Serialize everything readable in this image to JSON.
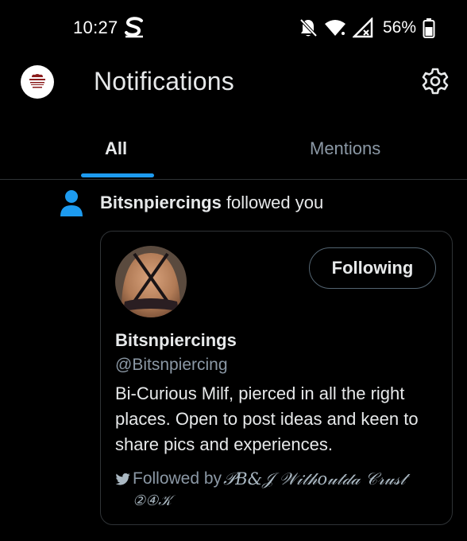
{
  "status_bar": {
    "time": "10:27",
    "carrier_icon": "s-letter-icon",
    "battery_percent": "56%"
  },
  "header": {
    "title": "Notifications",
    "avatar_icon": "avatar",
    "settings_icon": "gear-icon"
  },
  "tabs": [
    {
      "label": "All",
      "active": true
    },
    {
      "label": "Mentions",
      "active": false
    }
  ],
  "notification": {
    "icon": "person-icon",
    "actor": "Bitsnpiercings",
    "action": "followed you"
  },
  "profile_card": {
    "follow_button_label": "Following",
    "display_name": "Bitsnpiercings",
    "handle": "@Bitsnpiercing",
    "bio": "Bi-Curious Milf, pierced in all the right places. Open to post ideas and keen to share pics and experiences.",
    "followed_by_prefix": "Followed by",
    "followed_by_names": "𝒫𝐵&𝒥 𝒲𝒾𝓉𝒽𝑜𝓊𝓉𝒹𝒶 𝒞𝓇𝓊𝓈𝓉",
    "followed_by_second_line": "②④𝒦"
  },
  "colors": {
    "accent": "#1d9bf0",
    "background": "#000000",
    "text_primary": "#e7e9ea",
    "text_secondary": "#8b98a5",
    "border": "#2f3336"
  }
}
